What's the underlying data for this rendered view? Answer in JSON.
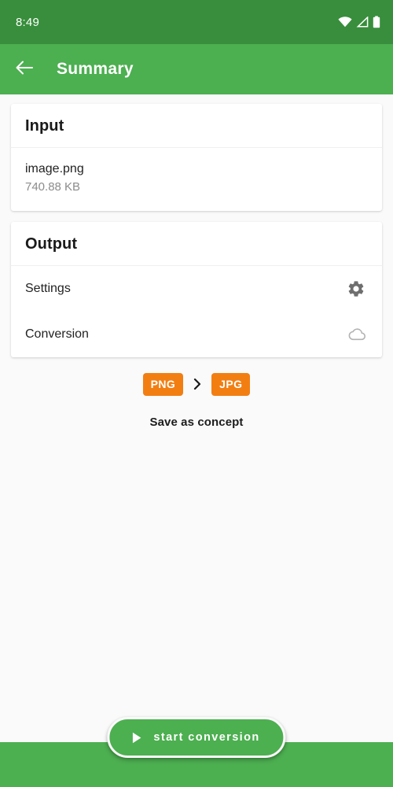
{
  "status_bar": {
    "time": "8:49",
    "icons": [
      "wifi-icon",
      "cellular-signal-icon",
      "battery-icon"
    ],
    "background": "#388e3c"
  },
  "app_bar": {
    "back_icon": "arrow-back-icon",
    "title": "Summary",
    "background": "#4caf50"
  },
  "input_card": {
    "header": "Input",
    "file_name": "image.png",
    "file_size": "740.88 KB"
  },
  "output_card": {
    "header": "Output",
    "rows": [
      {
        "label": "Settings",
        "icon": "gear-icon"
      },
      {
        "label": "Conversion",
        "icon": "cloud-icon"
      }
    ]
  },
  "format_conversion": {
    "source_format": "PNG",
    "target_format": "JPG",
    "separator_icon": "chevron-right-icon",
    "badge_color": "#f27e12"
  },
  "save_as_concept": "Save as concept",
  "start_button": {
    "label": "start conversion",
    "icon": "play-icon",
    "background": "#4caf50"
  }
}
